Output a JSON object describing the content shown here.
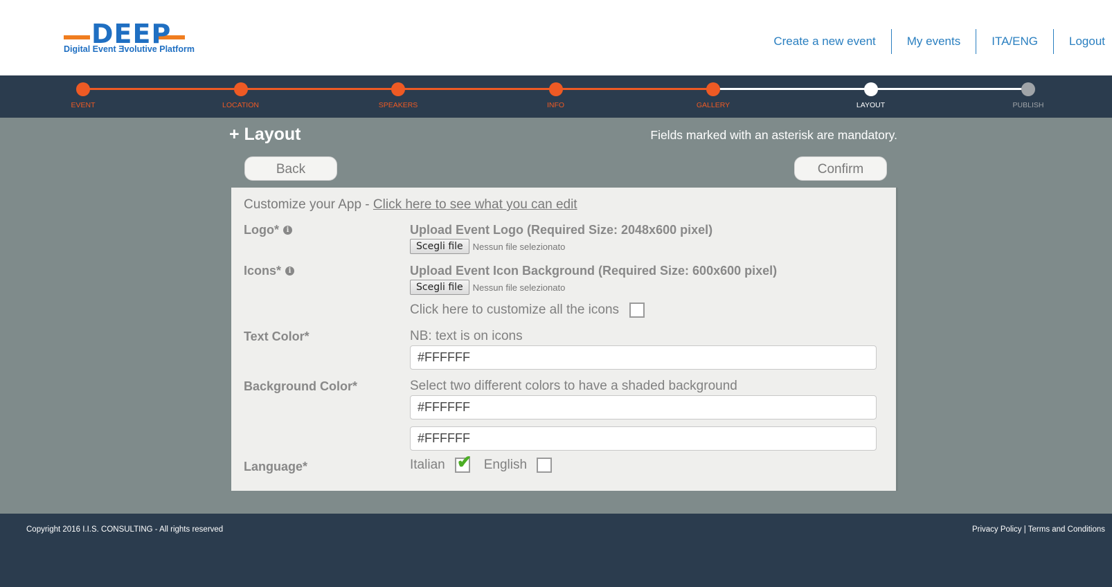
{
  "header": {
    "logo": {
      "word": "DEEP",
      "subtitle": "Digital Event Ǝvolutive Platform"
    },
    "nav": [
      {
        "label": "Create a new event"
      },
      {
        "label": "My events"
      },
      {
        "label": "ITA/ENG"
      },
      {
        "label": "Logout"
      }
    ]
  },
  "stepper": {
    "current_step": 6,
    "steps": [
      {
        "label": "EVENT",
        "state": "done"
      },
      {
        "label": "LOCATION",
        "state": "done"
      },
      {
        "label": "SPEAKERS",
        "state": "done"
      },
      {
        "label": "INFO",
        "state": "done"
      },
      {
        "label": "GALLERY",
        "state": "done"
      },
      {
        "label": "LAYOUT",
        "state": "current"
      },
      {
        "label": "PUBLISH",
        "state": "pending"
      }
    ],
    "colors": {
      "done": "#ee5a24",
      "current": "#ffffff",
      "pending": "#a0a4a8"
    }
  },
  "page": {
    "title": "+ Layout",
    "mandatory_note": "Fields marked with an asterisk are mandatory.",
    "back_label": "Back",
    "confirm_label": "Confirm"
  },
  "form": {
    "intro_text": "Customize your App - ",
    "intro_link": "Click here to see what you can edit",
    "logo": {
      "label": "Logo*",
      "upload_title": "Upload Event Logo (Required Size: 2048x600 pixel)",
      "file_button": "Scegli file",
      "file_status": "Nessun file selezionato"
    },
    "icons": {
      "label": "Icons*",
      "upload_title": "Upload Event Icon Background (Required Size: 600x600 pixel)",
      "file_button": "Scegli file",
      "file_status": "Nessun file selezionato",
      "customize_label": "Click here to customize all the icons",
      "customize_checked": false
    },
    "text_color": {
      "label": "Text Color*",
      "hint": "NB: text is on icons",
      "value": "#FFFFFF"
    },
    "background_color": {
      "label": "Background Color*",
      "hint": "Select two different colors to have a shaded background",
      "value_1": "#FFFFFF",
      "value_2": "#FFFFFF"
    },
    "language": {
      "label": "Language*",
      "options": [
        {
          "label": "Italian",
          "checked": true
        },
        {
          "label": "English",
          "checked": false
        }
      ]
    }
  },
  "footer": {
    "copyright": "Copyright 2016 I.I.S. CONSULTING - All rights reserved",
    "privacy": "Privacy Policy",
    "separator": "|",
    "terms": "Terms and Conditions"
  },
  "icons": {
    "info": "info-icon",
    "check": "checkmark-icon"
  }
}
